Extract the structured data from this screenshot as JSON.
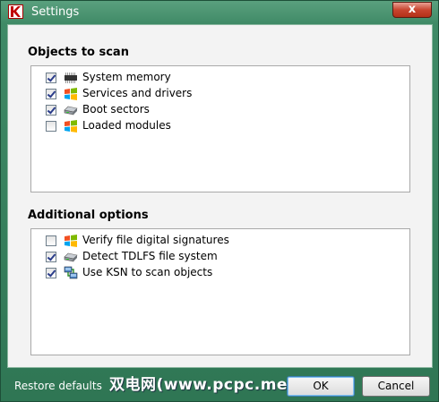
{
  "window": {
    "title": "Settings",
    "close_glyph": "x"
  },
  "scan_objects": {
    "title": "Objects to scan",
    "items": [
      {
        "label": "System memory",
        "checked": true,
        "icon": "memory-chip-icon"
      },
      {
        "label": "Services and drivers",
        "checked": true,
        "icon": "windows-flag-icon"
      },
      {
        "label": "Boot sectors",
        "checked": true,
        "icon": "disk-drive-icon"
      },
      {
        "label": "Loaded modules",
        "checked": false,
        "icon": "windows-flag-icon"
      }
    ]
  },
  "additional": {
    "title": "Additional options",
    "items": [
      {
        "label": "Verify file digital signatures",
        "checked": false,
        "icon": "windows-flag-icon"
      },
      {
        "label": "Detect TDLFS file system",
        "checked": true,
        "icon": "disk-drive-icon"
      },
      {
        "label": "Use KSN to scan objects",
        "checked": true,
        "icon": "network-icon"
      }
    ]
  },
  "footer": {
    "restore_label": "Restore defaults",
    "ok_label": "OK",
    "cancel_label": "Cancel",
    "watermark": "双电网(www.pcpc.me)"
  }
}
